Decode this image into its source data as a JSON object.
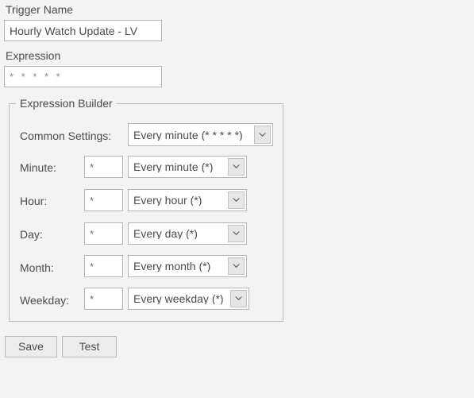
{
  "form": {
    "trigger_name": {
      "label": "Trigger Name",
      "value": "Hourly Watch Update - LV"
    },
    "expression": {
      "label": "Expression",
      "value": "* * * * *"
    }
  },
  "expression_builder": {
    "legend": "Expression Builder",
    "common_settings": {
      "label": "Common Settings:",
      "selected": "Every minute (* * * * *)"
    },
    "rows": [
      {
        "label": "Minute:",
        "field_value": "*",
        "selected": "Every minute (*)"
      },
      {
        "label": "Hour:",
        "field_value": "*",
        "selected": "Every hour (*)"
      },
      {
        "label": "Day:",
        "field_value": "*",
        "selected": "Every day (*)"
      },
      {
        "label": "Month:",
        "field_value": "*",
        "selected": "Every month (*)"
      },
      {
        "label": "Weekday:",
        "field_value": "*",
        "selected": "Every weekday (*)"
      }
    ]
  },
  "actions": {
    "save_label": "Save",
    "test_label": "Test"
  },
  "icons": {
    "dropdown": "chevron-down-icon"
  },
  "colors": {
    "page_background": "#f3f3f3",
    "text": "#4b4b4b",
    "input_background": "#ffffff",
    "input_border": "#b4b4b4",
    "fieldset_border": "#b9b9b9",
    "button_background": "#ececec",
    "button_border": "#bdbdbd",
    "arrow_background": "#e6e6e6",
    "placeholder_star": "#8a8a9a"
  }
}
